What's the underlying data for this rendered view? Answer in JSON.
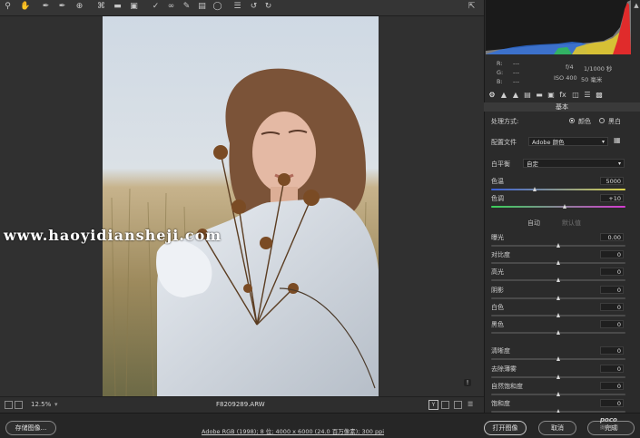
{
  "toolbar": {
    "tools": [
      "zoom-icon",
      "hand-icon",
      "white-balance-icon",
      "color-sampler-icon",
      "targeted-adjust-icon",
      "crop-icon",
      "straighten-icon",
      "transform-icon",
      "spot-removal-icon",
      "redeye-icon",
      "adjustment-brush-icon",
      "graduated-filter-icon",
      "radial-filter-icon",
      "preferences-icon",
      "rotate-left-icon",
      "rotate-right-icon"
    ]
  },
  "image": {
    "watermark": "www.haoyidiansheji.com"
  },
  "status": {
    "zoom": "12.5%",
    "filename": "F8209289.ARW"
  },
  "bottom": {
    "save_label": "存储图像...",
    "workflow": "Adobe RGB (1998); 8 位; 4000 x 6000 (24.0 百万像素); 300 ppi",
    "open_label": "打开图像",
    "cancel_label": "取消",
    "done_label": "完成",
    "brand": "poco",
    "brand_sub": "摄影专题"
  },
  "histogram": {
    "r_label": "R:",
    "g_label": "G:",
    "b_label": "B:",
    "r_val": "---",
    "g_val": "---",
    "b_val": "---",
    "aperture": "f/4",
    "shutter": "1/1000 秒",
    "iso": "ISO 400",
    "focal": "50 毫米"
  },
  "panel": {
    "section_title": "基本",
    "treatment_label": "处理方式:",
    "color_option": "颜色",
    "bw_option": "黑白",
    "profile_label": "配置文件",
    "profile_value": "Adobe 颜色",
    "wb_label": "白平衡",
    "wb_value": "自定",
    "auto_label": "自动",
    "default_label": "默认值",
    "sliders": [
      {
        "label": "色温",
        "value": "5000"
      },
      {
        "label": "色调",
        "value": "+10"
      },
      {
        "label": "曝光",
        "value": "0.00"
      },
      {
        "label": "对比度",
        "value": "0"
      },
      {
        "label": "高光",
        "value": "0"
      },
      {
        "label": "阴影",
        "value": "0"
      },
      {
        "label": "白色",
        "value": "0"
      },
      {
        "label": "黑色",
        "value": "0"
      },
      {
        "label": "清晰度",
        "value": "0"
      },
      {
        "label": "去除薄雾",
        "value": "0"
      },
      {
        "label": "自然饱和度",
        "value": "0"
      },
      {
        "label": "饱和度",
        "value": "0"
      }
    ],
    "slider_levels": [
      0.33,
      0.55,
      0.5,
      0.5,
      0.5,
      0.5,
      0.5,
      0.5,
      0.5,
      0.5,
      0.5,
      0.5
    ]
  }
}
